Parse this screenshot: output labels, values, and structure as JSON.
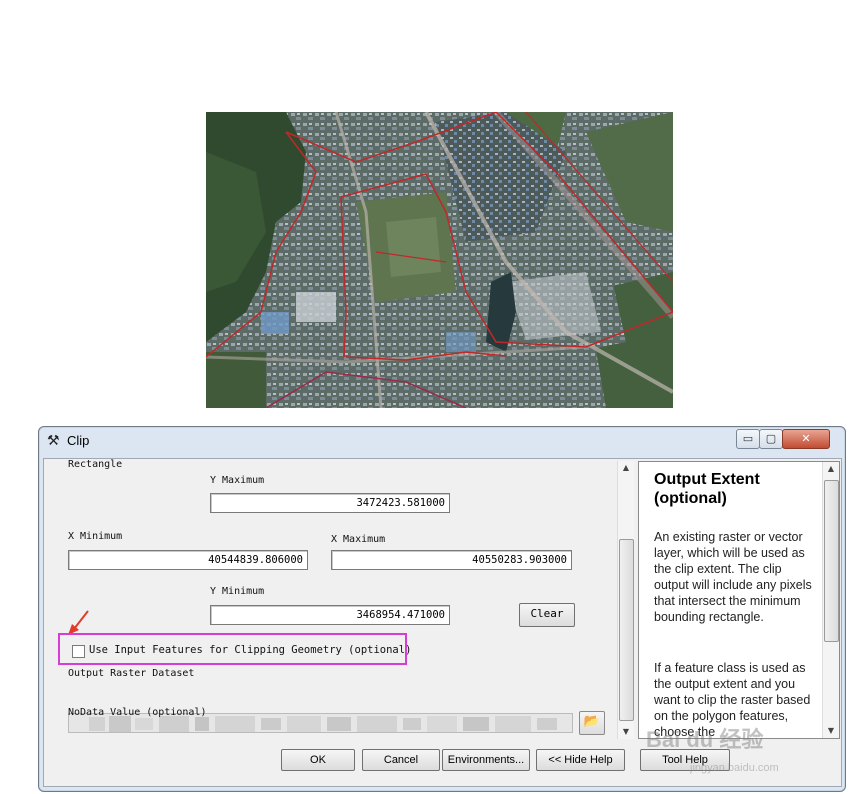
{
  "dialog": {
    "title": "Clip",
    "window_controls": {
      "minimize": "▭",
      "maximize": "▢",
      "close": "✕"
    }
  },
  "form": {
    "rectangle_label": "Rectangle",
    "y_max_label": "Y Maximum",
    "y_max_value": "3472423.581000",
    "x_min_label": "X Minimum",
    "x_min_value": "40544839.806000",
    "x_max_label": "X Maximum",
    "x_max_value": "40550283.903000",
    "y_min_label": "Y Minimum",
    "y_min_value": "3468954.471000",
    "clear_label": "Clear",
    "use_input_features_label": "Use Input Features for Clipping Geometry (optional)",
    "use_input_features_checked": false,
    "output_raster_label": "Output Raster Dataset",
    "nodata_label": "NoData Value (optional)",
    "nodata_value": ""
  },
  "help": {
    "title": "Output Extent (optional)",
    "paragraph1": "An existing raster or vector layer, which will be used as the clip extent. The clip output will include any pixels that intersect the minimum bounding rectangle.",
    "paragraph2": "If a feature class is used as the output extent and you want to clip the raster based on the polygon features, choose the"
  },
  "buttons": {
    "ok": "OK",
    "cancel": "Cancel",
    "environments": "Environments...",
    "hide_help": "<< Hide Help",
    "tool_help": "Tool Help"
  },
  "icons": {
    "title": "hammer-icon",
    "folder": "folder-open-icon",
    "arrow": "red-arrow-annotation"
  },
  "colors": {
    "highlight": "#d63dd6",
    "annotation_arrow": "#e23b2a"
  },
  "watermark": {
    "text": "Bai du 经验",
    "url": "jingyan.baidu.com"
  }
}
